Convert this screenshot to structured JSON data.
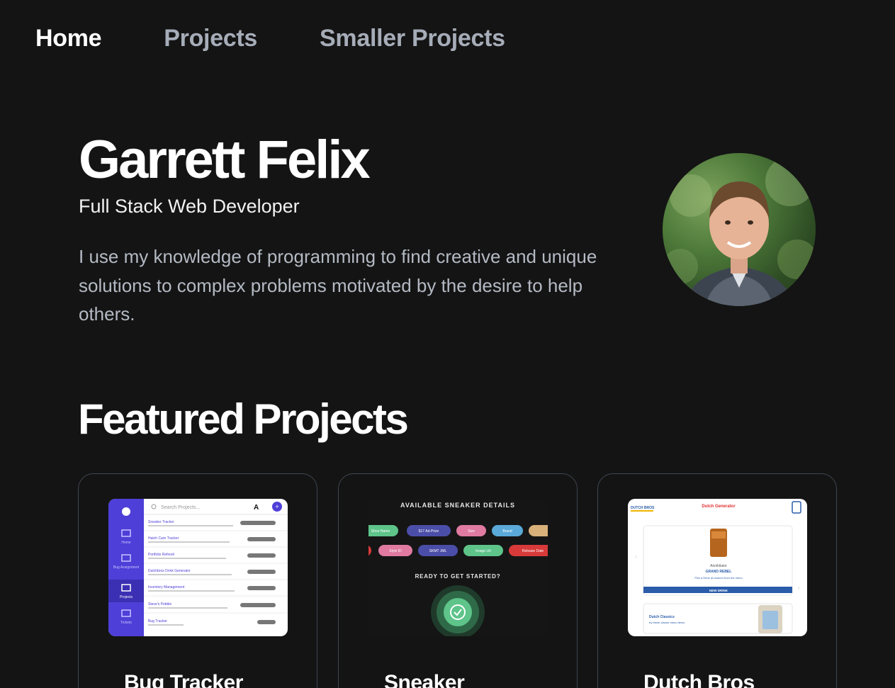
{
  "nav": {
    "home": "Home",
    "projects": "Projects",
    "smaller_projects": "Smaller Projects"
  },
  "hero": {
    "name": "Garrett Felix",
    "subtitle": "Full Stack Web Developer",
    "bio": "I use my knowledge of programming to find creative and unique solutions to complex problems motivated by the desire to help others."
  },
  "featured": {
    "title": "Featured Projects",
    "cards": [
      {
        "title": "Bug Tracker",
        "thumb": {
          "search_placeholder": "Search Projects...",
          "avatar_letter": "A",
          "nav_items": [
            "Home",
            "Bug Assignment",
            "Projects",
            "Tickets"
          ],
          "rows": [
            "Sneaker Tracker",
            "Hatch Care Tracker",
            "Portfolio Refresh",
            "Dutchbros Drink Generator",
            "Inventory Management",
            "Steve's Pebble",
            "Bug Tracker"
          ]
        }
      },
      {
        "title": "Sneaker",
        "thumb": {
          "heading": "AVAILABLE SNEAKER DETAILS",
          "cta": "READY TO GET STARTED?",
          "chips_row1": [
            "Shoe Name",
            "$17 Ad-Prize",
            "Size",
            "Brand",
            ""
          ],
          "chips_row2": [
            "",
            "Style ID",
            "SKMT JML",
            "Image Url",
            "Release Date"
          ]
        }
      },
      {
        "title": "Dutch Bros",
        "thumb": {
          "logo": "DUTCH BROS",
          "heading": "Dutch Generator",
          "drink_name": "Annihilator",
          "drink_sub": "GRAND REBEL",
          "drink_desc": "Pick a Drink at random from the menu",
          "button": "NEW DRINK",
          "footer_title": "Dutch Classics",
          "footer_sub": "try these classic menu items"
        }
      }
    ]
  },
  "colors": {
    "background": "#141414",
    "nav_inactive": "#a6acb8",
    "bio_text": "#b4bac4",
    "card_border": "#3f4652",
    "bug_sidebar": "#4e3fd8"
  }
}
